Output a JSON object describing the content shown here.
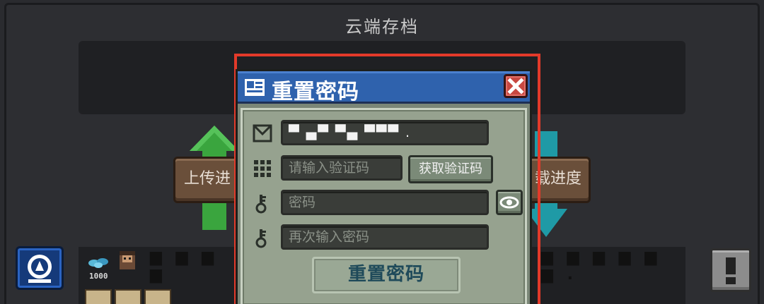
{
  "screen": {
    "title": "云端存档"
  },
  "backdrop": {
    "upload_label": "上传进",
    "download_label": "载进度",
    "coin_count": "1000"
  },
  "dialog": {
    "title": "重置密码",
    "account_value": "▀ ▄▀ ▀▄ ▀▀▀ .",
    "code_placeholder": "请输入验证码",
    "get_code_label": "获取验证码",
    "password_placeholder": "密码",
    "confirm_placeholder": "再次输入密码",
    "reset_label": "重置密码"
  },
  "colors": {
    "header_blue": "#2f62ad",
    "highlight_red": "#e33a2a",
    "dialog_body": "#96a28f"
  },
  "icons": {
    "header": "id-card-icon",
    "close": "close-icon",
    "account": "mail-icon",
    "code": "keypad-icon",
    "password": "key-icon",
    "confirm": "key-icon",
    "eye": "eye-icon"
  }
}
